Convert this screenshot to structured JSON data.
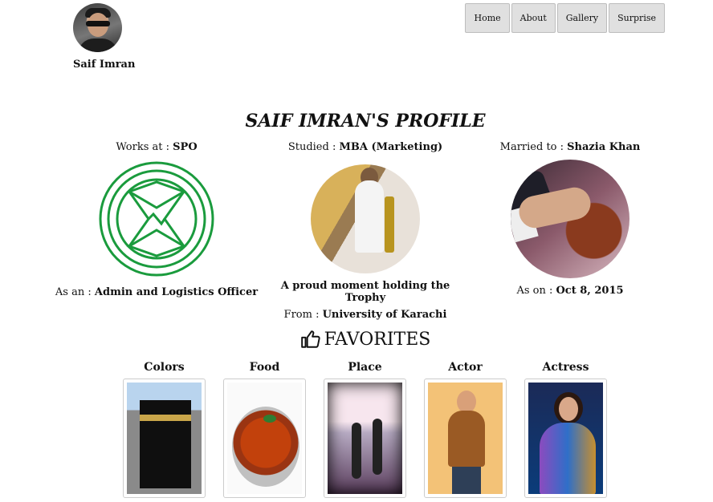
{
  "header": {
    "site_name": "Saif Imran",
    "nav": [
      {
        "label": "Home"
      },
      {
        "label": "About"
      },
      {
        "label": "Gallery"
      },
      {
        "label": "Surprise"
      }
    ]
  },
  "profile": {
    "title": "SAIF IMRAN'S PROFILE",
    "work": {
      "prefix": "Works at : ",
      "value": "SPO",
      "role_prefix": "As an : ",
      "role": "Admin and Logistics Officer"
    },
    "study": {
      "prefix": "Studied : ",
      "value": "MBA (Marketing)",
      "caption": "A proud moment holding the Trophy",
      "from_prefix": "From : ",
      "from": "University of Karachi"
    },
    "marriage": {
      "prefix": "Married to : ",
      "value": "Shazia Khan",
      "date_prefix": "As on : ",
      "date": "Oct 8, 2015"
    }
  },
  "favorites": {
    "heading": "FAVORITES",
    "icon": "thumbs-up-icon",
    "items": [
      {
        "label": "Colors"
      },
      {
        "label": "Food"
      },
      {
        "label": "Place"
      },
      {
        "label": "Actor"
      },
      {
        "label": "Actress"
      }
    ]
  },
  "colors": {
    "nav_bg": "#e0e0e0",
    "logo_green": "#1a9b3d"
  }
}
